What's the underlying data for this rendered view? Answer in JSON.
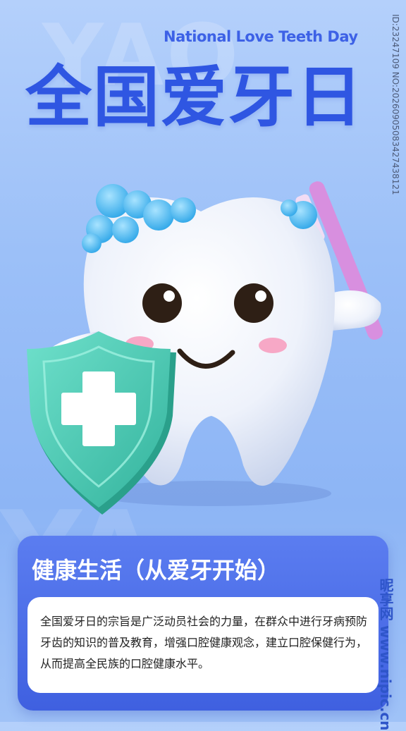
{
  "header": {
    "subtitle": "National Love Teeth Day",
    "title": "全国爱牙日"
  },
  "side_id": "ID:23247109 NO:20260905083427438121",
  "watermark": "昵享网 www.nipic.cn",
  "info_card": {
    "title": "健康生活（从爱牙开始）",
    "body": "全国爱牙日的宗旨是广泛动员社会的力量，在群众中进行牙病预防牙齿的知识的普及教育，增强口腔健康观念，建立口腔保健行为，从而提高全民族的口腔健康水平。"
  },
  "colors": {
    "title_blue": "#2f56e2",
    "shield_teal": "#4fc9b4",
    "toothbrush_pink": "#d88fdf",
    "foam_blue": "#4ab6ef"
  }
}
